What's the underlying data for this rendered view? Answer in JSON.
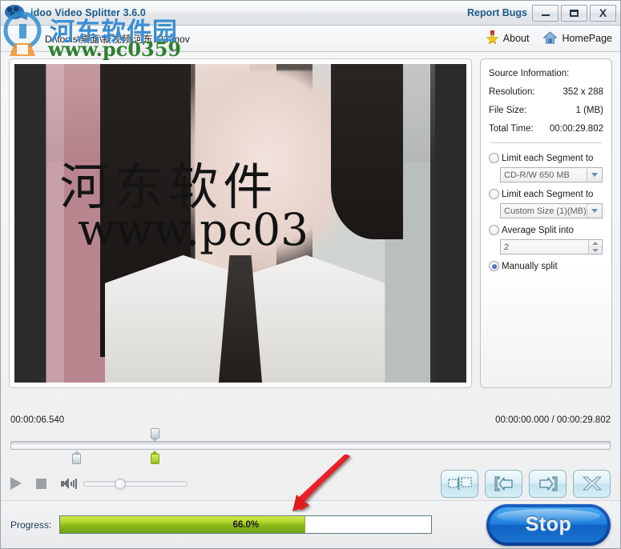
{
  "window": {
    "title": "idoo Video Splitter 3.6.0",
    "report_bugs": "Report Bugs",
    "minimize_label": "Minimize",
    "maximize_label": "Maximize",
    "close_label": "X"
  },
  "toolbar": {
    "file_path": "D:\\tools\\桌面\\新视频\\河东123.mov",
    "about_label": "About",
    "homepage_label": "HomePage"
  },
  "preview": {
    "watermark_cn": "河东软件",
    "watermark_url": "www.pc03"
  },
  "side_panel": {
    "source_information_title": "Source Information:",
    "rows": [
      {
        "label": "Resolution:",
        "value": "352 x 288"
      },
      {
        "label": "File Size:",
        "value": "1 (MB)"
      },
      {
        "label": "Total Time:",
        "value": "00:00:29.802"
      }
    ],
    "options": [
      {
        "id": "limit-segment-disc",
        "label": "Limit each Segment to",
        "selected": false,
        "control": "combo",
        "value": "CD-R/W 650 MB"
      },
      {
        "id": "limit-segment-custom",
        "label": "Limit each Segment to",
        "selected": false,
        "control": "combo",
        "value": "Custom Size (1)(MB)"
      },
      {
        "id": "average-split",
        "label": "Average Split into",
        "selected": false,
        "control": "spinner",
        "value": "2"
      },
      {
        "id": "manually-split",
        "label": "Manually split",
        "selected": true,
        "control": "none",
        "value": ""
      }
    ]
  },
  "timeline": {
    "current_time": "00:00:06.540",
    "range_time": "00:00:00.000 / 00:00:29.802",
    "playhead_percent": 24.0,
    "markers": [
      {
        "name": "segment-start-marker",
        "percent": 11.0,
        "color": "grey"
      },
      {
        "name": "segment-end-marker",
        "percent": 24.0,
        "color": "green"
      }
    ]
  },
  "controls": {
    "play_label": "Play",
    "stop_label": "Stop",
    "volume_label": "Volume",
    "volume_percent": 35,
    "segment_buttons": [
      {
        "name": "split-segment-button",
        "icon": "split-icon"
      },
      {
        "name": "set-start-point-button",
        "icon": "mark-in-icon"
      },
      {
        "name": "set-end-point-button",
        "icon": "mark-out-icon"
      },
      {
        "name": "delete-segment-button",
        "icon": "delete-x-icon"
      }
    ]
  },
  "progress": {
    "label": "Progress:",
    "percent_text": "66.0%",
    "percent": 66.0,
    "action_button": "Stop"
  },
  "colors": {
    "accent_blue": "#1e5a8a",
    "progress_green": "#86b61a",
    "stop_button_blue": "#1d7fdc",
    "arrow_red": "#e01b1b"
  }
}
